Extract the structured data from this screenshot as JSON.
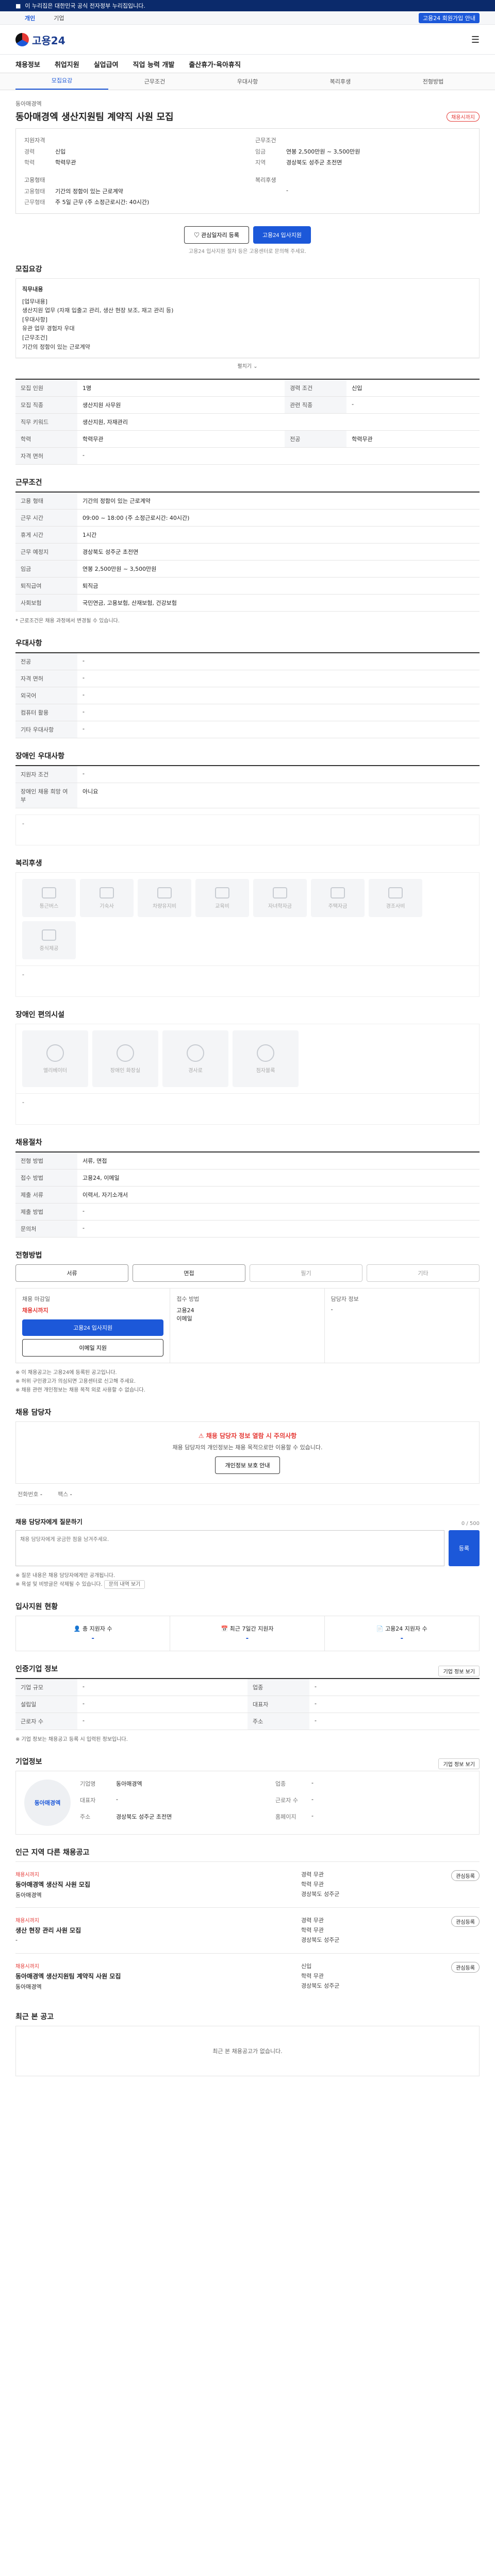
{
  "topbar": {
    "text": "이 누리집은 대한민국 공식 전자정부 누리집입니다."
  },
  "util": {
    "tabs": [
      "개인",
      "기업"
    ],
    "right": "고용24 회원가입 안내"
  },
  "header": {
    "logo": "고용24"
  },
  "gnb": [
    "채용정보",
    "취업지원",
    "실업급여",
    "직업 능력 개발",
    "출산휴가·육아휴직"
  ],
  "subtabs": [
    "모집요강",
    "근무조건",
    "우대사항",
    "복리후생",
    "전형방법"
  ],
  "job": {
    "company": "동아매경엑",
    "title": "동아매경엑 생산지원팀 계약직 사원 모집",
    "badge": "채용시까지",
    "summary": {
      "left_title": "지원자격",
      "left": [
        {
          "k": "경력",
          "v": "신입"
        },
        {
          "k": "학력",
          "v": "학력무관"
        }
      ],
      "right_title": "근무조건",
      "right": [
        {
          "k": "임금",
          "v": "연봉 2,500만원 ~ 3,500만원"
        },
        {
          "k": "지역",
          "v": "경상북도 성주군 초전면"
        }
      ],
      "left2_title": "고용형태",
      "left2": [
        {
          "k": "고용형태",
          "v": "기간의 정함이 있는 근로계약"
        },
        {
          "k": "근무형태",
          "v": "주 5일 근무 (주 소정근로시간: 40시간)"
        }
      ],
      "right2_title": "복리후생",
      "right2": [
        {
          "k": "",
          "v": "-"
        }
      ]
    },
    "btn_scrap": "관심일자리 등록",
    "btn_apply": "고용24 입사지원",
    "note": "고용24 입사지원 절차 등은 고용센터로 문의해 주세요."
  },
  "recruit": {
    "title": "모집요강",
    "desc_label": "직무내용",
    "desc_lines": [
      "[업무내용]",
      "생산지원 업무 (자재 입출고 관리, 생산 현장 보조, 재고 관리 등)",
      "",
      "[우대사항]",
      "유관 업무 경험자 우대",
      "",
      "[근무조건]",
      "기간의 정함이 있는 근로계약"
    ],
    "more": "펼치기",
    "rows": [
      {
        "k": "모집 인원",
        "v": "1명",
        "k2": "경력 조건",
        "v2": "신입"
      },
      {
        "k": "모집 직종",
        "v": "생산지원 사무원",
        "k2": "관련 직종",
        "v2": "-"
      },
      {
        "k": "직무 키워드",
        "v": "생산지원, 자재관리",
        "k2": "",
        "v2": ""
      },
      {
        "k": "학력",
        "v": "학력무관",
        "k2": "전공",
        "v2": "학력무관"
      },
      {
        "k": "자격 면허",
        "v": "-",
        "k2": "",
        "v2": ""
      }
    ]
  },
  "work": {
    "title": "근무조건",
    "rows": [
      {
        "k": "고용 형태",
        "v": "기간의 정함이 있는 근로계약"
      },
      {
        "k": "근무 시간",
        "v": "09:00 ~ 18:00 (주 소정근로시간: 40시간)"
      },
      {
        "k": "휴게 시간",
        "v": "1시간"
      },
      {
        "k": "근무 예정지",
        "v": "경상북도 성주군 초전면"
      },
      {
        "k": "임금",
        "v": "연봉 2,500만원 ~ 3,500만원"
      },
      {
        "k": "퇴직급여",
        "v": "퇴직금"
      },
      {
        "k": "사회보험",
        "v": "국민연금, 고용보험, 산재보험, 건강보험"
      }
    ],
    "note": "* 근로조건은 채용 과정에서 변경될 수 있습니다."
  },
  "prefer": {
    "title": "우대사항",
    "rows": [
      {
        "k": "전공",
        "v": "-"
      },
      {
        "k": "자격 면허",
        "v": "-"
      },
      {
        "k": "외국어",
        "v": "-"
      },
      {
        "k": "컴퓨터 활용",
        "v": "-"
      },
      {
        "k": "기타 우대사항",
        "v": "-"
      }
    ]
  },
  "disabled": {
    "title": "장애인 우대사항",
    "rows": [
      {
        "k": "지원자 조건",
        "v": "-"
      },
      {
        "k": "장애인 채용 희망 여부",
        "v": "아니요"
      }
    ],
    "empty": "-"
  },
  "welfare": {
    "title": "복리후생",
    "icons": [
      "통근버스",
      "기숙사",
      "차량유지비",
      "교육비",
      "자녀학자금",
      "주택자금",
      "경조사비",
      "중식제공"
    ],
    "empty": "-"
  },
  "facility": {
    "title": "장애인 편의시설",
    "icons": [
      "엘리베이터",
      "장애인 화장실",
      "경사로",
      "점자블록"
    ],
    "empty": "-"
  },
  "selection": {
    "title": "채용절차",
    "rows": [
      {
        "k": "전형 방법",
        "v": "서류, 면접"
      },
      {
        "k": "접수 방법",
        "v": "고용24, 이메일"
      },
      {
        "k": "제출 서류",
        "v": "이력서, 자기소개서"
      },
      {
        "k": "제출 방법",
        "v": "-"
      },
      {
        "k": "문의처",
        "v": "-"
      }
    ]
  },
  "method": {
    "title": "전형방법",
    "tabs": [
      "서류",
      "면접",
      "필기",
      "기타"
    ],
    "c1_title": "채용 마감일",
    "c1_red": "채용시까지",
    "c1_btn": "고용24 입사지원",
    "c1_btn2": "이메일 지원",
    "c2_title": "접수 방법",
    "c2_v": "고용24",
    "c2_v2": "이메일",
    "c3_title": "담당자 정보",
    "c3_v": "-",
    "notes": [
      "※ 이 채용공고는 고용24에 등록된 공고입니다.",
      "※ 허위 구인광고가 의심되면 고용센터로 신고해 주세요.",
      "※ 채용 관련 개인정보는 채용 목적 외로 사용할 수 없습니다."
    ]
  },
  "contact": {
    "title": "채용 담당자",
    "warn_title": "채용 담당자 정보 열람 시 주의사항",
    "warn_text": "채용 담당자의 개인정보는 채용 목적으로만 이용할 수 있습니다.",
    "btn": "개인정보 보호 안내",
    "phone_label": "전화번호",
    "phone": "-",
    "fax_label": "팩스",
    "fax": "-"
  },
  "reply": {
    "title": "채용 담당자에게 질문하기",
    "placeholder": "채용 담당자에게 궁금한 점을 남겨주세요.",
    "count": "0 / 500",
    "btn": "등록",
    "notes": [
      "※ 질문 내용은 채용 담당자에게만 공개됩니다.",
      "※ 욕설 및 비방글은 삭제될 수 있습니다."
    ],
    "link": "문의 내역 보기"
  },
  "apply_status": {
    "title": "입사지원 현황",
    "items": [
      {
        "label": "총 지원자 수",
        "v": "-"
      },
      {
        "label": "최근 7일간 지원자",
        "v": "-"
      },
      {
        "label": "고용24 지원자 수",
        "v": "-"
      }
    ]
  },
  "recruit_info": {
    "title": "인증기업 정보",
    "btn": "기업 정보 보기",
    "rows": [
      {
        "k": "기업 규모",
        "v": "-",
        "k2": "업종",
        "v2": "-"
      },
      {
        "k": "설립일",
        "v": "-",
        "k2": "대표자",
        "v2": "-"
      },
      {
        "k": "근로자 수",
        "v": "-",
        "k2": "주소",
        "v2": "-"
      }
    ],
    "note": "※ 기업 정보는 채용공고 등록 시 입력된 정보입니다."
  },
  "company": {
    "title": "기업정보",
    "btn": "기업 정보 보기",
    "logo": "동아매경엑",
    "kv": [
      {
        "k": "기업명",
        "v": "동아매경엑"
      },
      {
        "k": "업종",
        "v": "-"
      },
      {
        "k": "대표자",
        "v": "-"
      },
      {
        "k": "근로자 수",
        "v": "-"
      },
      {
        "k": "주소",
        "v": "경상북도 성주군 초전면"
      },
      {
        "k": "홈페이지",
        "v": "-"
      }
    ]
  },
  "other_jobs": {
    "title": "인근 지역 다른 채용공고",
    "items": [
      {
        "tag": "채용시까지",
        "title": "동아매경엑 생산직 사원 모집",
        "company": "동아매경엑",
        "meta": [
          "경력 무관",
          "학력 무관",
          "경상북도 성주군"
        ],
        "btn": "관심등록"
      },
      {
        "tag": "채용시까지",
        "title": "생산 현장 관리 사원 모집",
        "company": "-",
        "meta": [
          "경력 무관",
          "학력 무관",
          "경상북도 성주군"
        ],
        "btn": "관심등록"
      },
      {
        "tag": "채용시까지",
        "title": "동아매경엑 생산지원팀 계약직 사원 모집",
        "company": "동아매경엑",
        "meta": [
          "신입",
          "학력 무관",
          "경상북도 성주군"
        ],
        "btn": "관심등록"
      }
    ]
  },
  "recent": {
    "title": "최근 본 공고",
    "empty": "최근 본 채용공고가 없습니다."
  }
}
